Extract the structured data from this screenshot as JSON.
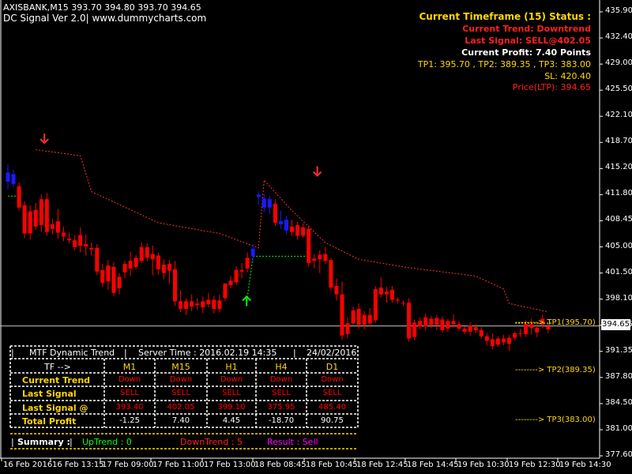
{
  "header": {
    "line1": "AXISBANK,M15  393.70 394.80 393.70 394.65",
    "line2": "DC Signal Ver 2.0| www.dummycharts.com"
  },
  "info": {
    "timeframe": "Current Timeframe (15) Status :",
    "trend": "Current Trend: Downtrend",
    "last_signal": "Last Signal: SELL@402.05",
    "profit": "Current Profit: 7.40 Points",
    "targets": "TP1: 395.70 , TP2: 389.35 , TP3: 383.00",
    "sl": "SL: 420.40",
    "ltp": "Price(LTP): 394.65"
  },
  "colors": {
    "bear": "#ff0000",
    "bull": "#1a1aff",
    "stop": "#ff3030",
    "gold": "#ffd700",
    "green": "#00ff00",
    "magenta": "#ff00ff"
  },
  "price_axis": [
    "435.90",
    "432.40",
    "429.00",
    "425.50",
    "422.10",
    "418.70",
    "415.20",
    "411.80",
    "408.45",
    "405.00",
    "401.50",
    "398.10",
    "394.65",
    "391.35",
    "387.80",
    "384.50",
    "381.00",
    "377.60"
  ],
  "current_price": "394.65",
  "time_axis": [
    "16 Feb 2016",
    "16 Feb 13:15",
    "17 Feb 09:00",
    "17 Feb 11:00",
    "17 Feb 13:00",
    "18 Feb 08:45",
    "18 Feb 10:45",
    "18 Feb 12:45",
    "18 Feb 14:45",
    "19 Feb 10:30",
    "19 Feb 12:30",
    "19 Feb 14:30"
  ],
  "targets_lines": {
    "tp1": "--------> TP1(395.70)",
    "tp2": "--------> TP2(389.35)",
    "tp3": "--------> TP3(383.00)"
  },
  "panel": {
    "title": "MTF Dynamic Trend",
    "server_time": "Server Time : 2016.02.19 14:35",
    "date": "24/02/2016",
    "tf_label": "TF -->",
    "columns": [
      "M1",
      "M15",
      "H1",
      "H4",
      "D1"
    ],
    "rows": [
      {
        "label": "Current Trend",
        "values": [
          "Down",
          "Down",
          "Down",
          "Down",
          "Down"
        ]
      },
      {
        "label": "Last Signal",
        "values": [
          "SELL",
          "SELL",
          "SELL",
          "SELL",
          "SELL"
        ]
      },
      {
        "label": "Last Signal @",
        "values": [
          "393.40",
          "402.05",
          "399.10",
          "375.95",
          "485.40"
        ]
      },
      {
        "label": "Total Profit",
        "values": [
          "-1.25",
          "7.40",
          "4.45",
          "-18.70",
          "90.75"
        ]
      }
    ],
    "summary_label": "Summary :",
    "uptrend": "UpTrend : 0",
    "downtrend": "DownTrend : 5",
    "result": "Result : Sell"
  },
  "chart_data": {
    "type": "candlestick",
    "ylim": [
      377.6,
      437.6
    ],
    "candles": [
      [
        414.8,
        415.9,
        412.6,
        413.6
      ],
      [
        414.6,
        415.2,
        412.9,
        413.3
      ],
      [
        413.0,
        413.5,
        409.8,
        410.2
      ],
      [
        410.5,
        411.0,
        406.2,
        406.8
      ],
      [
        406.8,
        410.5,
        406.0,
        409.7
      ],
      [
        409.9,
        410.8,
        407.3,
        407.7
      ],
      [
        407.9,
        411.9,
        407.0,
        411.3
      ],
      [
        411.3,
        412.1,
        406.5,
        407.0
      ],
      [
        407.4,
        408.7,
        406.7,
        408.0
      ],
      [
        408.4,
        410.0,
        406.1,
        406.9
      ],
      [
        406.9,
        407.7,
        405.8,
        406.4
      ],
      [
        406.1,
        406.9,
        405.5,
        405.9
      ],
      [
        405.9,
        406.6,
        404.6,
        405.0
      ],
      [
        405.2,
        407.6,
        404.3,
        406.6
      ],
      [
        405.4,
        406.7,
        403.9,
        405.1
      ],
      [
        404.9,
        405.6,
        403.9,
        404.7
      ],
      [
        404.9,
        405.4,
        401.3,
        401.8
      ],
      [
        402.0,
        402.8,
        399.8,
        400.3
      ],
      [
        400.5,
        403.3,
        399.4,
        402.6
      ],
      [
        402.4,
        403.0,
        398.6,
        399.0
      ],
      [
        399.6,
        401.6,
        398.8,
        401.1
      ],
      [
        401.7,
        403.2,
        400.9,
        402.8
      ],
      [
        403.2,
        404.4,
        401.2,
        402.2
      ],
      [
        402.4,
        404.0,
        402.1,
        403.6
      ],
      [
        403.2,
        405.6,
        402.9,
        405.0
      ],
      [
        405.0,
        405.5,
        403.1,
        403.6
      ],
      [
        403.4,
        405.2,
        401.3,
        404.1
      ],
      [
        403.9,
        404.3,
        401.4,
        402.1
      ],
      [
        402.7,
        403.4,
        400.8,
        401.6
      ],
      [
        401.9,
        403.3,
        400.2,
        402.8
      ],
      [
        402.1,
        403.2,
        397.3,
        397.9
      ],
      [
        397.9,
        399.4,
        396.5,
        396.9
      ],
      [
        396.9,
        398.3,
        396.1,
        397.9
      ],
      [
        397.9,
        398.8,
        396.6,
        397.2
      ],
      [
        397.6,
        398.3,
        396.8,
        397.4
      ],
      [
        397.1,
        398.5,
        396.3,
        397.9
      ],
      [
        397.5,
        399.0,
        397.1,
        398.1
      ],
      [
        398.1,
        398.6,
        396.3,
        396.9
      ],
      [
        396.9,
        398.8,
        396.5,
        398.0
      ],
      [
        398.3,
        400.3,
        397.9,
        400.2
      ],
      [
        400.0,
        401.2,
        399.6,
        400.6
      ],
      [
        400.4,
        402.5,
        400.0,
        402.0
      ],
      [
        401.8,
        402.9,
        400.9,
        402.0
      ],
      [
        402.2,
        404.3,
        401.7,
        403.6
      ],
      [
        403.8,
        405.4,
        403.1,
        404.8
      ],
      [
        411.9,
        412.3,
        410.6,
        411.6
      ],
      [
        411.4,
        412.0,
        409.6,
        410.2
      ],
      [
        410.2,
        411.7,
        409.4,
        411.3
      ],
      [
        410.7,
        411.3,
        407.8,
        408.2
      ],
      [
        408.0,
        409.8,
        407.4,
        408.4
      ],
      [
        408.6,
        409.1,
        406.7,
        407.2
      ],
      [
        407.0,
        408.6,
        406.5,
        407.7
      ],
      [
        407.9,
        408.3,
        406.0,
        406.5
      ],
      [
        406.5,
        408.1,
        406.2,
        407.6
      ],
      [
        407.4,
        407.9,
        402.4,
        402.9
      ],
      [
        403.2,
        404.1,
        402.2,
        403.5
      ],
      [
        403.4,
        404.6,
        401.6,
        404.0
      ],
      [
        404.1,
        405.0,
        402.8,
        403.2
      ],
      [
        403.3,
        403.6,
        399.3,
        399.7
      ],
      [
        399.9,
        400.9,
        398.0,
        398.8
      ],
      [
        398.8,
        400.5,
        392.8,
        393.4
      ],
      [
        393.6,
        395.8,
        393.0,
        395.0
      ],
      [
        395.0,
        397.2,
        394.8,
        396.7
      ],
      [
        396.9,
        397.6,
        394.3,
        394.8
      ],
      [
        394.8,
        396.6,
        394.2,
        396.1
      ],
      [
        396.1,
        397.0,
        394.5,
        395.0
      ],
      [
        395.4,
        399.9,
        395.1,
        399.5
      ],
      [
        399.7,
        401.0,
        398.4,
        398.8
      ],
      [
        398.8,
        399.8,
        397.7,
        399.2
      ],
      [
        399.4,
        399.9,
        397.7,
        398.1
      ],
      [
        398.1,
        398.4,
        397.6,
        398.0
      ],
      [
        397.6,
        398.0,
        397.2,
        397.7
      ],
      [
        397.7,
        398.3,
        392.6,
        393.0
      ],
      [
        393.2,
        395.5,
        392.8,
        395.1
      ],
      [
        395.3,
        395.8,
        394.2,
        394.6
      ],
      [
        394.6,
        396.3,
        394.0,
        395.8
      ],
      [
        395.6,
        396.0,
        394.4,
        394.8
      ],
      [
        394.8,
        396.1,
        394.1,
        395.7
      ],
      [
        395.5,
        395.9,
        393.8,
        394.1
      ],
      [
        394.3,
        395.6,
        393.9,
        395.3
      ],
      [
        395.3,
        396.2,
        394.4,
        394.9
      ],
      [
        394.9,
        395.3,
        394.0,
        394.3
      ],
      [
        394.3,
        394.6,
        393.6,
        393.9
      ],
      [
        393.9,
        395.1,
        393.4,
        394.7
      ],
      [
        394.5,
        394.9,
        393.7,
        394.1
      ],
      [
        394.1,
        394.5,
        393.0,
        393.3
      ],
      [
        393.3,
        393.7,
        392.1,
        392.7
      ],
      [
        392.9,
        393.7,
        391.6,
        392.0
      ],
      [
        392.2,
        393.3,
        391.9,
        393.0
      ],
      [
        393.0,
        393.5,
        392.1,
        392.5
      ],
      [
        392.3,
        393.5,
        391.4,
        393.1
      ],
      [
        393.1,
        393.9,
        392.8,
        393.7
      ],
      [
        393.7,
        394.3,
        393.2,
        393.6
      ],
      [
        393.6,
        395.4,
        393.2,
        394.9
      ],
      [
        394.9,
        395.6,
        393.5,
        394.4
      ],
      [
        394.4,
        395.1,
        393.2,
        393.8
      ],
      [
        394.8,
        396.1,
        394.3,
        395.6
      ],
      [
        394.6,
        395.0,
        393.7,
        394.2
      ]
    ],
    "bull_indices": [
      0,
      1,
      44,
      45,
      46,
      47,
      49,
      50
    ],
    "stop_line": [
      [
        5,
        417.8
      ],
      [
        13,
        417.0
      ],
      [
        15,
        412.3
      ],
      [
        27,
        408.2
      ],
      [
        38,
        406.8
      ],
      [
        45,
        404.9
      ],
      [
        46,
        413.8
      ],
      [
        51,
        409.8
      ],
      [
        57,
        405.6
      ],
      [
        63,
        403.4
      ],
      [
        72,
        402.3
      ],
      [
        84,
        401.2
      ],
      [
        89,
        399.5
      ],
      [
        90,
        397.6
      ],
      [
        97,
        396.5
      ]
    ],
    "support_segments": [
      [
        [
          0,
          411.7
        ],
        [
          2,
          411.7
        ]
      ],
      [
        [
          44,
          403.8
        ],
        [
          54,
          403.8
        ]
      ],
      [
        [
          43,
          398.4
        ],
        [
          44,
          403.8
        ]
      ]
    ],
    "sell_arrows": [
      [
        4,
        419.3
      ],
      [
        53,
        415.0
      ]
    ],
    "buy_arrow": [
      [
        44,
        398.3
      ]
    ]
  }
}
